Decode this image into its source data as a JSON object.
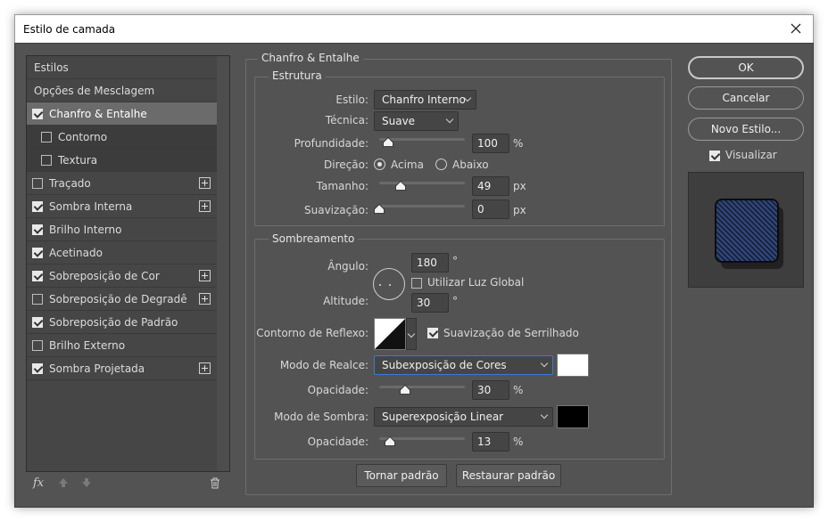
{
  "window": {
    "title": "Estilo de camada"
  },
  "sidebar": {
    "items": [
      {
        "label": "Estilos",
        "checkbox": false,
        "checked": false,
        "plus": false
      },
      {
        "label": "Opções de Mesclagem",
        "checkbox": false,
        "checked": false,
        "plus": false
      },
      {
        "label": "Chanfro & Entalhe",
        "checkbox": true,
        "checked": true,
        "plus": false,
        "selected": true
      },
      {
        "label": "Contorno",
        "checkbox": true,
        "checked": false,
        "plus": false,
        "sub": true
      },
      {
        "label": "Textura",
        "checkbox": true,
        "checked": false,
        "plus": false,
        "sub": true
      },
      {
        "label": "Traçado",
        "checkbox": true,
        "checked": false,
        "plus": true
      },
      {
        "label": "Sombra Interna",
        "checkbox": true,
        "checked": true,
        "plus": true
      },
      {
        "label": "Brilho Interno",
        "checkbox": true,
        "checked": true,
        "plus": false
      },
      {
        "label": "Acetinado",
        "checkbox": true,
        "checked": true,
        "plus": false
      },
      {
        "label": "Sobreposição de Cor",
        "checkbox": true,
        "checked": true,
        "plus": true
      },
      {
        "label": "Sobreposição de Degradê",
        "checkbox": true,
        "checked": false,
        "plus": true
      },
      {
        "label": "Sobreposição de Padrão",
        "checkbox": true,
        "checked": true,
        "plus": false
      },
      {
        "label": "Brilho Externo",
        "checkbox": true,
        "checked": false,
        "plus": false
      },
      {
        "label": "Sombra Projetada",
        "checkbox": true,
        "checked": true,
        "plus": true
      }
    ],
    "fx_label": "fx"
  },
  "bevel": {
    "section_title": "Chanfro & Entalhe",
    "structure": {
      "title": "Estrutura",
      "style_label": "Estilo:",
      "style_value": "Chanfro Interno",
      "technique_label": "Técnica:",
      "technique_value": "Suave",
      "depth_label": "Profundidade:",
      "depth_value": "100",
      "depth_unit": "%",
      "depth_level": 0.1,
      "direction_label": "Direção:",
      "direction_up": "Acima",
      "direction_down": "Abaixo",
      "size_label": "Tamanho:",
      "size_value": "49",
      "size_unit": "px",
      "size_level": 0.25,
      "soften_label": "Suavização:",
      "soften_value": "0",
      "soften_unit": "px",
      "soften_level": 0.0
    },
    "shading": {
      "title": "Sombreamento",
      "angle_label": "Ângulo:",
      "angle_value": "180",
      "angle_unit": "°",
      "global_light_label": "Utilizar Luz Global",
      "global_light_checked": false,
      "altitude_label": "Altitude:",
      "altitude_value": "30",
      "altitude_unit": "°",
      "gloss_label": "Contorno de Reflexo:",
      "antialias_label": "Suavização de Serrilhado",
      "antialias_checked": true,
      "highlight_mode_label": "Modo de Realce:",
      "highlight_mode_value": "Subexposição de Cores",
      "highlight_color": "#ffffff",
      "highlight_opacity_label": "Opacidade:",
      "highlight_opacity_value": "30",
      "highlight_opacity_unit": "%",
      "highlight_opacity_level": 0.3,
      "shadow_mode_label": "Modo de Sombra:",
      "shadow_mode_value": "Superexposição Linear",
      "shadow_color": "#000000",
      "shadow_opacity_label": "Opacidade:",
      "shadow_opacity_value": "13",
      "shadow_opacity_unit": "%",
      "shadow_opacity_level": 0.13
    },
    "make_default": "Tornar padrão",
    "reset_default": "Restaurar padrão"
  },
  "actions": {
    "ok": "OK",
    "cancel": "Cancelar",
    "new_style": "Novo Estilo...",
    "preview_label": "Visualizar",
    "preview_checked": true
  }
}
